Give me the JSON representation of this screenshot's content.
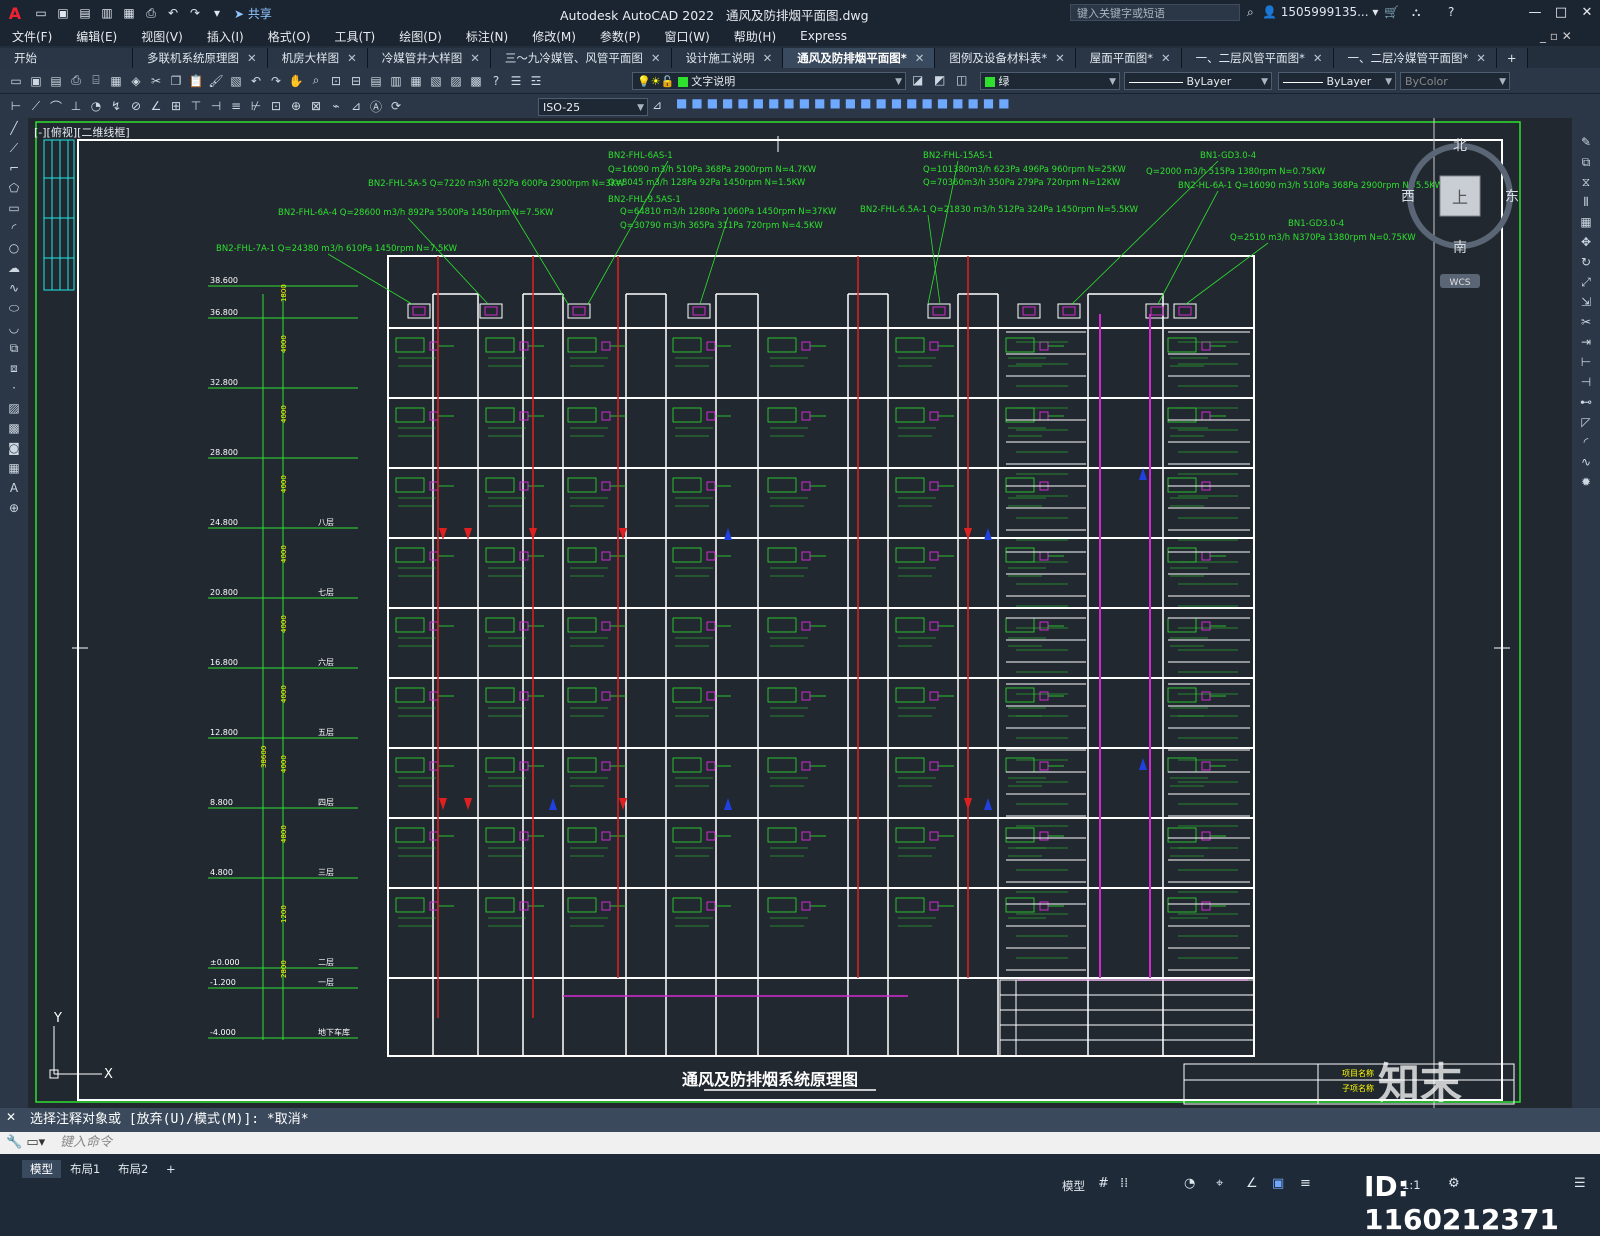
{
  "app": {
    "title": "Autodesk AutoCAD 2022",
    "filename": "通风及防排烟平面图.dwg",
    "share_label": "共享",
    "search_placeholder": "键入关键字或短语",
    "user": "1505999135...",
    "logo": "A"
  },
  "menu": [
    "文件(F)",
    "编辑(E)",
    "视图(V)",
    "插入(I)",
    "格式(O)",
    "工具(T)",
    "绘图(D)",
    "标注(N)",
    "修改(M)",
    "参数(P)",
    "窗口(W)",
    "帮助(H)",
    "Express"
  ],
  "tabs": [
    {
      "label": "开始",
      "close": false
    },
    {
      "label": "多联机系统原理图",
      "close": true
    },
    {
      "label": "机房大样图",
      "close": true
    },
    {
      "label": "冷媒管井大样图",
      "close": true
    },
    {
      "label": "三～九冷媒管、风管平面图",
      "close": true
    },
    {
      "label": "设计施工说明",
      "close": true
    },
    {
      "label": "通风及防排烟平面图*",
      "close": true,
      "active": true
    },
    {
      "label": "图例及设备材料表*",
      "close": true
    },
    {
      "label": "屋面平面图*",
      "close": true
    },
    {
      "label": "一、二层风管平面图*",
      "close": true
    },
    {
      "label": "一、二层冷媒管平面图*",
      "close": true
    }
  ],
  "toolbar": {
    "layer": "文字说明",
    "color": "绿",
    "linetype": "ByLayer",
    "lineweight": "ByLayer",
    "plotstyle": "ByColor",
    "dimstyle": "ISO-25"
  },
  "view_label": "[-][俯视][二维线框]",
  "viewcube": {
    "north": "北",
    "south": "南",
    "east": "东",
    "west": "西",
    "top": "上",
    "wcs": "WCS"
  },
  "drawing": {
    "title": "通风及防排烟系统原理图",
    "ucs_y": "Y",
    "ucs_x": "X",
    "elevations": [
      "38.600",
      "36.800",
      "32.800",
      "28.800",
      "24.800",
      "20.800",
      "16.800",
      "12.800",
      "8.800",
      "4.800",
      "±0.000",
      "-1.200",
      "-4.000"
    ],
    "floors": [
      "八层",
      "七层",
      "六层",
      "五层",
      "四层",
      "三层",
      "二层",
      "一层",
      "地下车库"
    ],
    "heights": [
      "1800",
      "4000",
      "4000",
      "4000",
      "4000",
      "4000",
      "4000",
      "4000",
      "4800",
      "1200",
      "2800"
    ],
    "total_height": "38600",
    "fan_labels": [
      "BN2-FHL-7A-1  Q=24380 m3/h  610Pa  1450rpm  N=7.5KW",
      "BN2-FHL-6A-4  Q=28600 m3/h  892Pa 5500Pa 1450rpm N=7.5KW",
      "BN2-FHL-5A-5  Q=7220 m3/h  852Pa 600Pa 2900rpm N=3KW",
      "BN2-FHL-6AS-1",
      "Q=16090 m3/h  510Pa 368Pa 2900rpm N=4.7KW",
      "Q=8045 m3/h  128Pa 92Pa 1450rpm N=1.5KW",
      "BN2-FHL-9.5AS-1",
      "Q=64810 m3/h  1280Pa 1060Pa 1450rpm N=37KW",
      "Q=30790 m3/h  365Pa 311Pa 720rpm N=4.5KW",
      "BN2-FHL-15AS-1",
      "Q=101380m3/h  623Pa 496Pa 960rpm N=25KW",
      "Q=70360m3/h  350Pa 279Pa 720rpm N=12KW",
      "BN2-FHL-6.5A-1  Q=21830 m3/h  512Pa 324Pa 1450rpm N=5.5KW",
      "BN1-GD3.0-4",
      "Q=2000 m3/h  515Pa 1380rpm N=0.75KW",
      "BN2-HL-6A-1  Q=16090 m3/h  510Pa 368Pa 2900rpm N=5.5KW",
      "BN1-GD3.0-4",
      "Q=2510 m3/h  N370Pa 1380rpm N=0.75KW"
    ],
    "titleblock": [
      "项目名称",
      "子项名称"
    ]
  },
  "command": {
    "history": "选择注释对象或 [放弃(U)/模式(M)]: *取消*",
    "input_placeholder": "键入命令"
  },
  "layouts": [
    "模型",
    "布局1",
    "布局2"
  ],
  "status": {
    "model_label": "模型",
    "scale": "1:1",
    "id_text": "ID: 1160212371",
    "watermark_brand": "知末"
  },
  "colors": {
    "accent_green": "#2fe02f",
    "magenta": "#d22ad2",
    "red": "#e02020",
    "blue": "#2040e0",
    "cyan": "#1ee6e6"
  }
}
